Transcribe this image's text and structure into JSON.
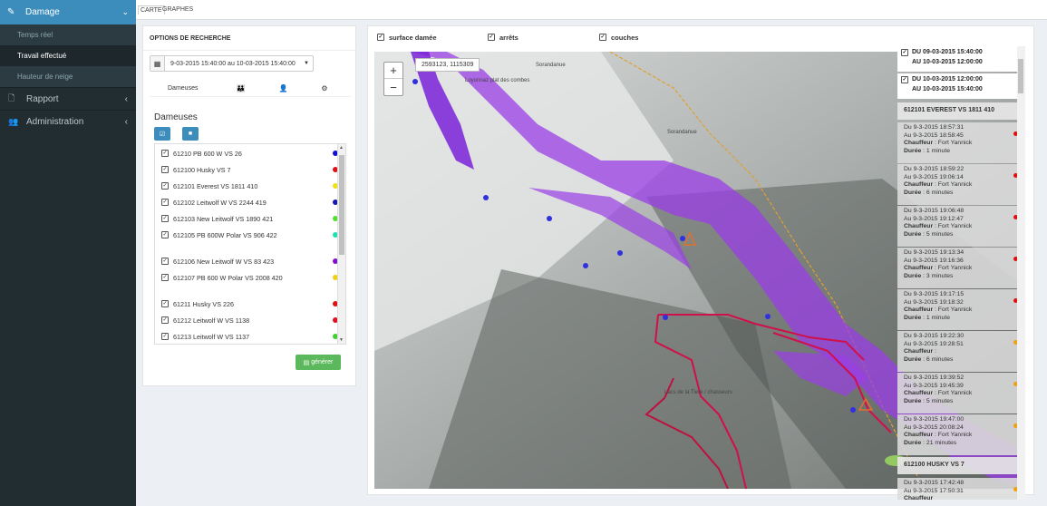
{
  "sidebar": {
    "top_item": {
      "label": "Damage",
      "icon": "brush-icon"
    },
    "sub_items": [
      {
        "label": "Temps réel",
        "active": false
      },
      {
        "label": "Travail effectué",
        "active": true
      },
      {
        "label": "Hauteur de neige",
        "active": false
      }
    ],
    "items": [
      {
        "label": "Rapport",
        "icon": "file-icon"
      },
      {
        "label": "Administration",
        "icon": "users-icon"
      }
    ]
  },
  "tabs": {
    "carte": "CARTE",
    "graphes": "GRAPHES"
  },
  "search_panel": {
    "title": "OPTIONS DE RECHERCHE",
    "date_range": "9-03-2015 15:40:00 au 10-03-2015 15:40:00",
    "subtab_label": "Dameuses",
    "section_label": "Dameuses",
    "generate_label": "générer",
    "machines": [
      {
        "name": "61210 PB 600 W VS 26",
        "color": "#1010d0"
      },
      {
        "name": "612100 Husky VS 7",
        "color": "#e0101a"
      },
      {
        "name": "612101 Everest VS 1811 410",
        "color": "#f0e010"
      },
      {
        "name": "612102 Leitwolf W VS 2244 419",
        "color": "#1818b0"
      },
      {
        "name": "612103 New Leitwolf VS 1890 421",
        "color": "#50e030"
      },
      {
        "name": "612105 PB 600W Polar VS 906 422",
        "color": "#20e0b0"
      },
      {
        "name": "612106 New Leitwolf W VS 83 423",
        "color": "#8010d0"
      },
      {
        "name": "612107 PB 600 W Polar VS 2008 420",
        "color": "#f0d010"
      },
      {
        "name": "61211 Husky VS 226",
        "color": "#e01010"
      },
      {
        "name": "61212 Leitwolf W VS 1138",
        "color": "#e01020"
      },
      {
        "name": "61213 Leitwolf W VS 1137",
        "color": "#40d030"
      }
    ]
  },
  "layers": {
    "surface": "surface damée",
    "arrets": "arrêts",
    "couches": "couches"
  },
  "map": {
    "coords": "2593123, 1115309",
    "labels": [
      "Sorandanue",
      "Sorandanue",
      "Loyonnaz plat des combes",
      "Lacs de la Tiere / chasseurs"
    ]
  },
  "periods": [
    {
      "line1": "DU 09-03-2015 15:40:00",
      "line2": "AU 10-03-2015 12:00:00"
    },
    {
      "line1": "DU 10-03-2015 12:00:00",
      "line2": "AU 10-03-2015 15:40:00"
    }
  ],
  "groups": [
    {
      "title": "612101 EVEREST VS 1811 410"
    },
    {
      "title": "612100 HUSKY VS 7"
    }
  ],
  "labels": {
    "chauffeur": "Chauffeur",
    "duree": "Durée"
  },
  "entries": [
    {
      "du": "Du 9-3-2015 18:57:31",
      "au": "Au 9-3-2015 18:58:45",
      "chauffeur": " : Fort Yannick",
      "duree": " : 1 minute",
      "color": "#e01010"
    },
    {
      "du": "Du 9-3-2015 18:59:22",
      "au": "Au 9-3-2015 19:06:14",
      "chauffeur": " : Fort Yannick",
      "duree": " : 6 minutes",
      "color": "#e01010"
    },
    {
      "du": "Du 9-3-2015 19:06:48",
      "au": "Au 9-3-2015 19:12:47",
      "chauffeur": " : Fort Yannick",
      "duree": " : 5 minutes",
      "color": "#e01010"
    },
    {
      "du": "Du 9-3-2015 19:13:34",
      "au": "Au 9-3-2015 19:16:36",
      "chauffeur": " : Fort Yannick",
      "duree": " : 3 minutes",
      "color": "#e01010"
    },
    {
      "du": "Du 9-3-2015 19:17:15",
      "au": "Au 9-3-2015 19:18:32",
      "chauffeur": " : Fort Yannick",
      "duree": " : 1 minute",
      "color": "#e01010"
    },
    {
      "du": "Du 9-3-2015 19:22:30",
      "au": "Au 9-3-2015 19:28:51",
      "chauffeur": " :",
      "duree": " : 6 minutes",
      "color": "#f0a010"
    },
    {
      "du": "Du 9-3-2015 19:39:52",
      "au": "Au 9-3-2015 19:45:39",
      "chauffeur": " : Fort Yannick",
      "duree": " : 5 minutes",
      "color": "#f0a010"
    },
    {
      "du": "Du 9-3-2015 19:47:00",
      "au": "Au 9-3-2015 20:08:24",
      "chauffeur": " : Fort Yannick",
      "duree": " : 21 minutes",
      "color": "#f0a010"
    },
    {
      "du": "Du 9-3-2015 17:42:48",
      "au": "Au 9-3-2015 17:50:31",
      "chauffeur": "",
      "duree": "",
      "color": "#f0a010"
    }
  ]
}
